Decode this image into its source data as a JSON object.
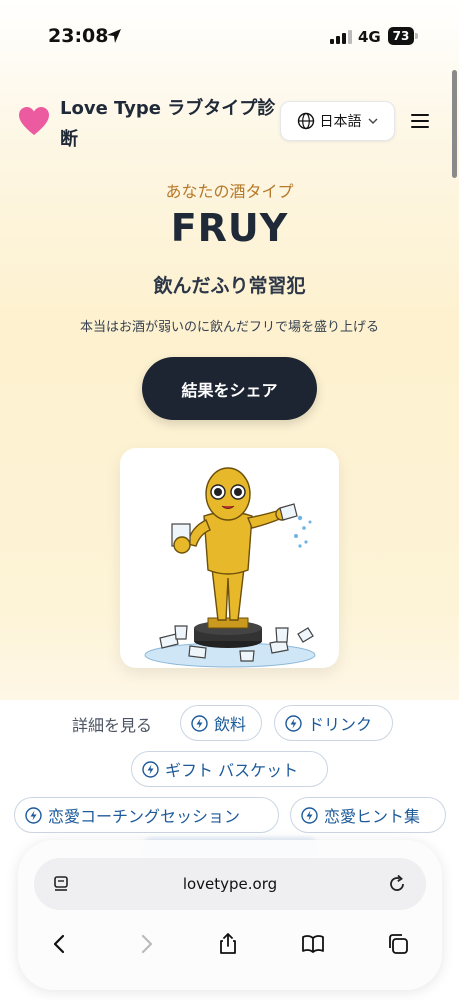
{
  "status_bar": {
    "time": "23:08",
    "network": "4G",
    "battery": "73"
  },
  "header": {
    "brand": "Love Type ラブタイプ診断",
    "language": "日本語"
  },
  "hero": {
    "eyebrow": "あなたの酒タイプ",
    "type_code": "FRUY",
    "type_name": "飲んだふり常習犯",
    "description": "本当はお酒が弱いのに飲んだフリで場を盛り上げる",
    "share_label": "結果をシェア"
  },
  "details": {
    "label": "詳細を見る",
    "chips": [
      "飲料",
      "ドリンク",
      "ギフト バスケット",
      "恋愛コーチングセッション",
      "恋愛ヒント集"
    ]
  },
  "browser": {
    "url": "lovetype.org"
  },
  "colors": {
    "accent": "#1e2532",
    "link": "#1d5a9a",
    "eyebrow": "#b7792a",
    "heart": "#ec5aa0"
  }
}
